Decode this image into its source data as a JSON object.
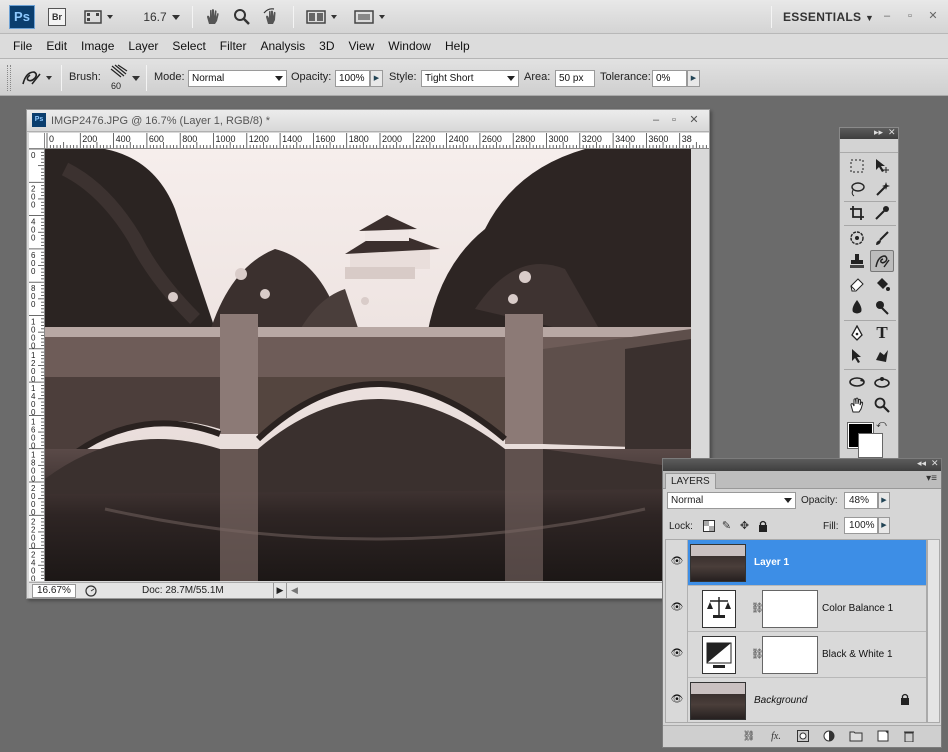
{
  "appbar": {
    "logo": "Ps",
    "bridge_logo": "Br",
    "zoom": "16.7",
    "workspace": "ESSENTIALS"
  },
  "menu": [
    "File",
    "Edit",
    "Image",
    "Layer",
    "Select",
    "Filter",
    "Analysis",
    "3D",
    "View",
    "Window",
    "Help"
  ],
  "options": {
    "brush_label": "Brush:",
    "brush_size": "60",
    "mode_label": "Mode:",
    "mode_value": "Normal",
    "opacity_label": "Opacity:",
    "opacity_value": "100%",
    "style_label": "Style:",
    "style_value": "Tight Short",
    "area_label": "Area:",
    "area_value": "50 px",
    "tolerance_label": "Tolerance:",
    "tolerance_value": "0%"
  },
  "document": {
    "title": "IMGP2476.JPG @ 16.7% (Layer 1, RGB/8) *",
    "zoom": "16.67%",
    "doc_info": "Doc: 28.7M/55.1M",
    "ruler_h": [
      "0",
      "200",
      "400",
      "600",
      "800",
      "1000",
      "1200",
      "1400",
      "1600",
      "1800",
      "2000",
      "2200",
      "2400",
      "2600",
      "2800",
      "3000",
      "3200",
      "3400",
      "3600",
      "38"
    ],
    "ruler_v": [
      "0",
      "2\n0\n0",
      "4\n0\n0",
      "6\n0\n0",
      "8\n0\n0",
      "1\n0\n0\n0",
      "1\n2\n0\n0",
      "1\n4\n0\n0",
      "1\n6\n0\n0",
      "1\n8\n0\n0",
      "2\n0\n0\n0",
      "2\n2\n0\n0",
      "2\n4\n0\n0"
    ]
  },
  "layers_panel": {
    "tab": "LAYERS",
    "blend_mode": "Normal",
    "opacity_label": "Opacity:",
    "opacity_value": "48%",
    "lock_label": "Lock:",
    "fill_label": "Fill:",
    "fill_value": "100%",
    "layers": [
      {
        "name": "Layer 1",
        "selected": true
      },
      {
        "name": "Color Balance 1",
        "selected": false
      },
      {
        "name": "Black & White 1",
        "selected": false
      },
      {
        "name": "Background",
        "selected": false
      }
    ]
  },
  "colors": {
    "accent_selection": "#3d8ee6",
    "foreground": "#000000",
    "background": "#ffffff"
  }
}
